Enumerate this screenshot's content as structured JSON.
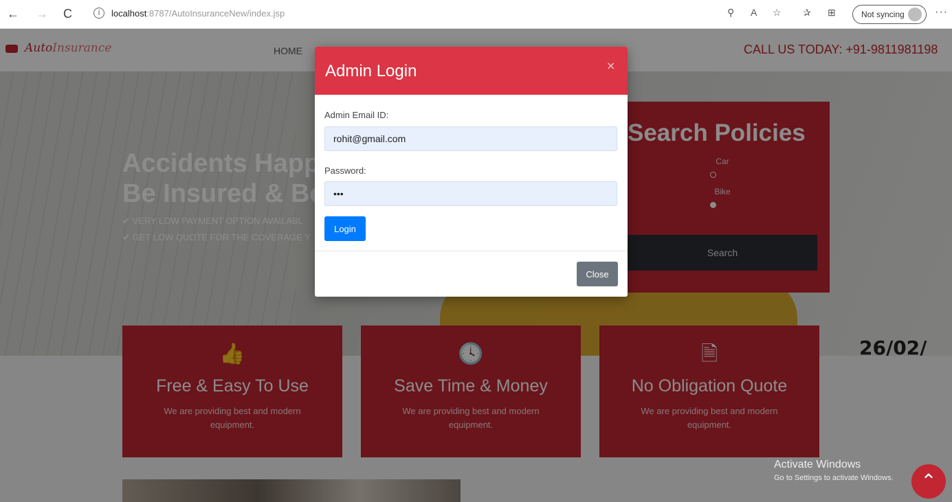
{
  "browser": {
    "back_icon": "←",
    "forward_icon": "→",
    "reload_icon": "C",
    "info_icon": "i",
    "url_host": "localhost",
    "url_rest": ":8787/AutoInsuranceNew/index.jsp",
    "sync_label": "Not syncing",
    "more_icon": "···"
  },
  "site": {
    "logo_dark": "Auto",
    "logo_light": "Insurance",
    "nav_home": "HOME",
    "call_us": "CALL US TODAY: +91-9811981198"
  },
  "hero": {
    "title_line1": "Accidents Happe",
    "title_line2": "Be Insured & Be",
    "bullet1": "✔ VERY LOW PAYMENT OPTION AVAILABL",
    "bullet2": "✔ GET LOW QUOTE FOR THE COVERAGE Y",
    "date_fragment": "26/02/"
  },
  "search": {
    "title": "Search Policies",
    "option1": "Car",
    "option2": "Bike",
    "button": "Search"
  },
  "features": [
    {
      "icon": "thumbs-up-icon",
      "glyph": "👍",
      "title": "Free & Easy To Use",
      "desc": "We are providing best and modern equipment."
    },
    {
      "icon": "clock-icon",
      "glyph": "🕓",
      "title": "Save Time & Money",
      "desc": "We are providing best and modern equipment."
    },
    {
      "icon": "document-icon",
      "glyph": "🗎",
      "title": "No Obligation Quote",
      "desc": "We are providing best and modern equipment."
    }
  ],
  "watermark": {
    "line1": "Activate Windows",
    "line2": "Go to Settings to activate Windows."
  },
  "scroll_top_icon": "⌃",
  "modal": {
    "title": "Admin Login",
    "close_x": "×",
    "email_label": "Admin Email ID:",
    "email_value": "rohit@gmail.com",
    "password_label": "Password:",
    "password_value": "•••",
    "login_button": "Login",
    "close_button": "Close"
  },
  "colors": {
    "brand_red": "#c12632",
    "modal_header": "#dc3545",
    "primary_blue": "#007bff",
    "secondary_gray": "#6c757d"
  }
}
